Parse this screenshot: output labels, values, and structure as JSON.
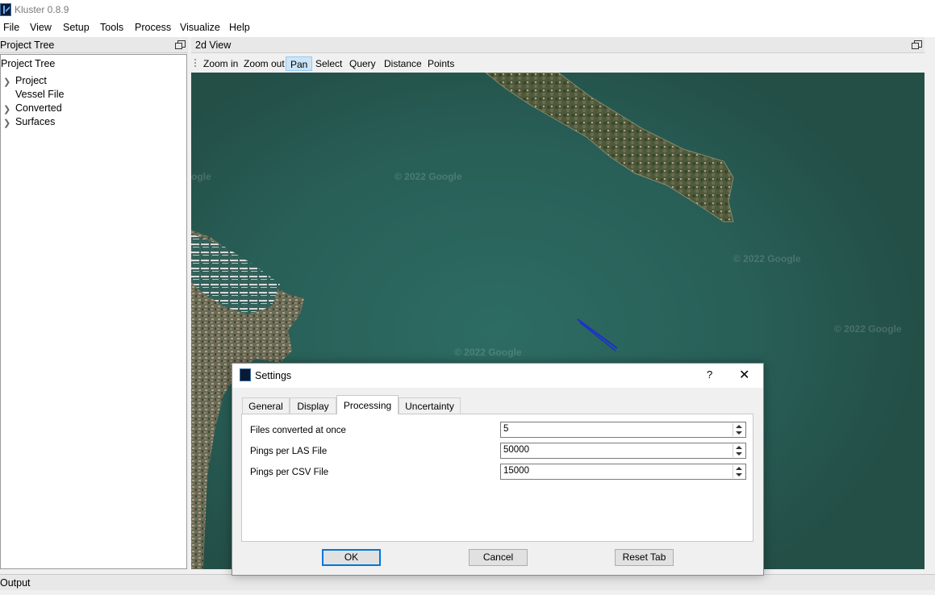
{
  "app": {
    "title": "Kluster 0.8.9"
  },
  "menu": [
    "File",
    "View",
    "Setup",
    "Tools",
    "Process",
    "Visualize",
    "Help"
  ],
  "project_tree": {
    "dock_title": "Project Tree",
    "header": "Project Tree",
    "items": [
      {
        "label": "Project",
        "expandable": true
      },
      {
        "label": "Vessel File",
        "expandable": false
      },
      {
        "label": "Converted",
        "expandable": true
      },
      {
        "label": "Surfaces",
        "expandable": true
      }
    ]
  },
  "view2d": {
    "dock_title": "2d View",
    "toolbar": [
      "Zoom in",
      "Zoom out",
      "Pan",
      "Select",
      "Query",
      "Distance",
      "Points"
    ],
    "active_tool": "Pan",
    "watermark": "© 2022 Google",
    "watermark_partial": "ogle"
  },
  "output": {
    "dock_title": "Output"
  },
  "settings_dialog": {
    "title": "Settings",
    "help": "?",
    "tabs": [
      "General",
      "Display",
      "Processing",
      "Uncertainty"
    ],
    "active_tab": "Processing",
    "fields": [
      {
        "label": "Files converted at once",
        "value": "5"
      },
      {
        "label": "Pings per LAS File",
        "value": "50000"
      },
      {
        "label": "Pings per CSV File",
        "value": "15000"
      }
    ],
    "buttons": {
      "ok": "OK",
      "cancel": "Cancel",
      "reset": "Reset Tab"
    }
  },
  "colors": {
    "water": "#2d6c63",
    "accent": "#0078d7",
    "track_line": "#1a2fd0"
  }
}
